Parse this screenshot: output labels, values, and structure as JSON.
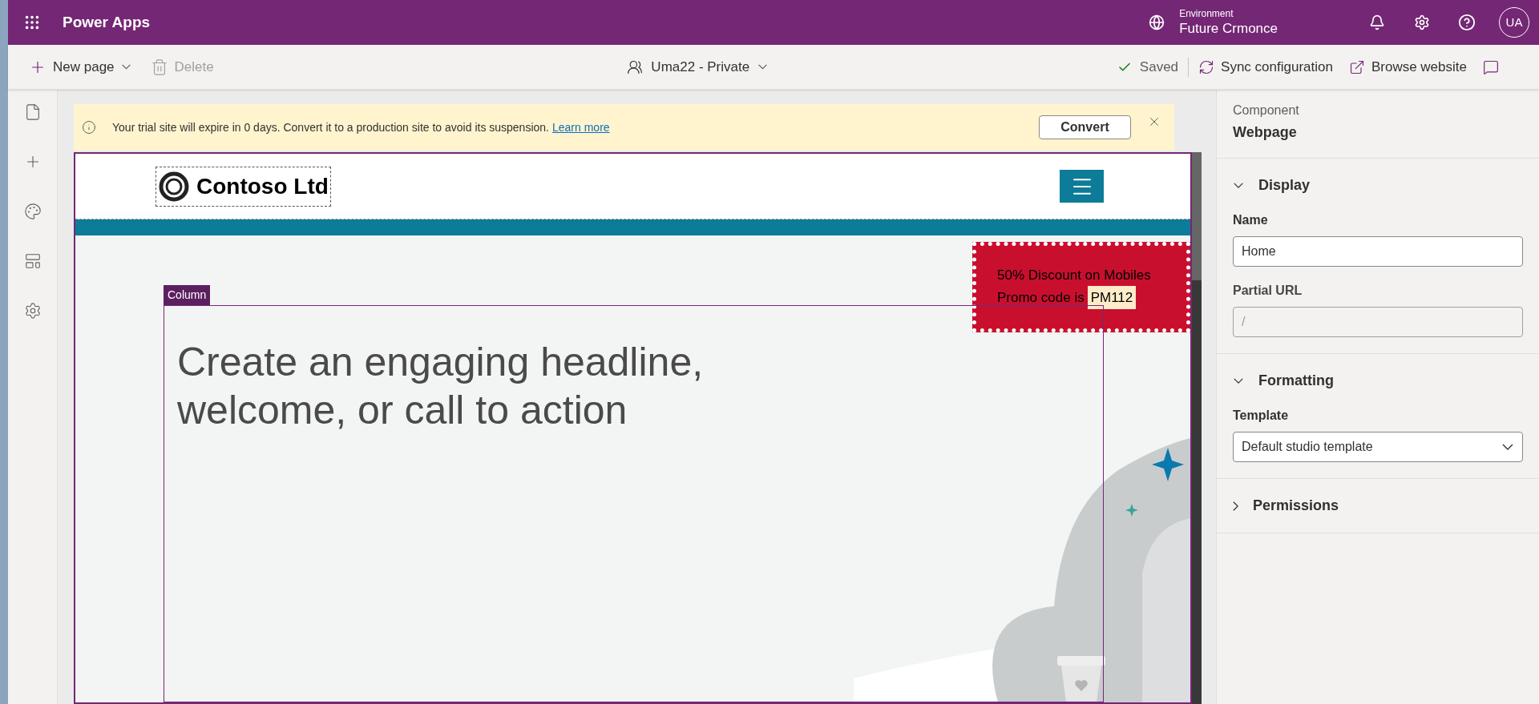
{
  "top_bar": {
    "app_title": "Power Apps",
    "environment_label": "Environment",
    "environment_name": "Future Crmonce",
    "avatar_initials": "UA"
  },
  "toolbar": {
    "commands": [
      {
        "kind": "new",
        "label": "New page",
        "disabled": false,
        "caret": true
      },
      {
        "kind": "delete",
        "label": "Delete",
        "disabled": true,
        "caret": false
      }
    ],
    "site": "Uma22 - Private",
    "status": "Saved",
    "actions": [
      {
        "kind": "sync",
        "label": "Sync configuration"
      },
      {
        "kind": "browse",
        "label": "Browse website"
      },
      {
        "kind": "feedback"
      }
    ]
  },
  "left_rail": [
    {
      "kind": "pages",
      "selected": false
    },
    {
      "kind": "add",
      "selected": false
    },
    {
      "kind": "styling",
      "selected": false
    },
    {
      "kind": "templates",
      "selected": false
    },
    {
      "kind": "settings",
      "selected": false
    }
  ],
  "banner": {
    "message": "Your trial site will expire in 0 days. Convert it to a production site to avoid its suspension.",
    "link": "Learn more",
    "button": "Convert"
  },
  "canvas": {
    "logo_text": "Contoso Ltd",
    "promo": {
      "line_1": "50% Discount on Mobiles",
      "line_2": "Promo code is",
      "code": "PM112"
    },
    "column_label": "Column",
    "headline": [
      "Create an engaging headline,",
      "welcome, or call to action"
    ]
  },
  "panel": {
    "component_label": "Component",
    "component_name": "Webpage",
    "sections": [
      {
        "title": "Display",
        "expanded": true,
        "fields": [
          {
            "kind": "text",
            "label": "Name",
            "value": "Home",
            "disabled": false
          },
          {
            "kind": "text",
            "label": "Partial URL",
            "value": "/",
            "disabled": true
          }
        ]
      },
      {
        "title": "Formatting",
        "expanded": true,
        "fields": [
          {
            "kind": "select",
            "label": "Template",
            "value": "Default studio template"
          }
        ]
      },
      {
        "title": "Permissions",
        "expanded": false
      }
    ]
  }
}
